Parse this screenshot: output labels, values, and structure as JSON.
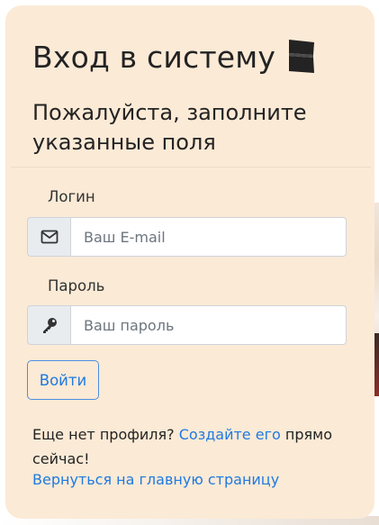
{
  "login_card": {
    "title": "Вход в систему",
    "title_icon": "book-icon",
    "subtitle": "Пожалуйста, заполните указанные поля",
    "login_field": {
      "label": "Логин",
      "icon": "envelope-icon",
      "placeholder": "Ваш E-mail",
      "value": ""
    },
    "password_field": {
      "label": "Пароль",
      "icon": "key-icon",
      "placeholder": "Ваш пароль",
      "value": ""
    },
    "submit_label": "Войти",
    "signup_prompt": "Еще нет профиля?",
    "signup_link": "Создайте его",
    "signup_suffix": "прямо сейчас!",
    "back_link": "Вернуться на главную страницу"
  },
  "colors": {
    "card_background": "#fbead6",
    "link": "#1f7ae0",
    "addon_background": "#e9ecef"
  }
}
